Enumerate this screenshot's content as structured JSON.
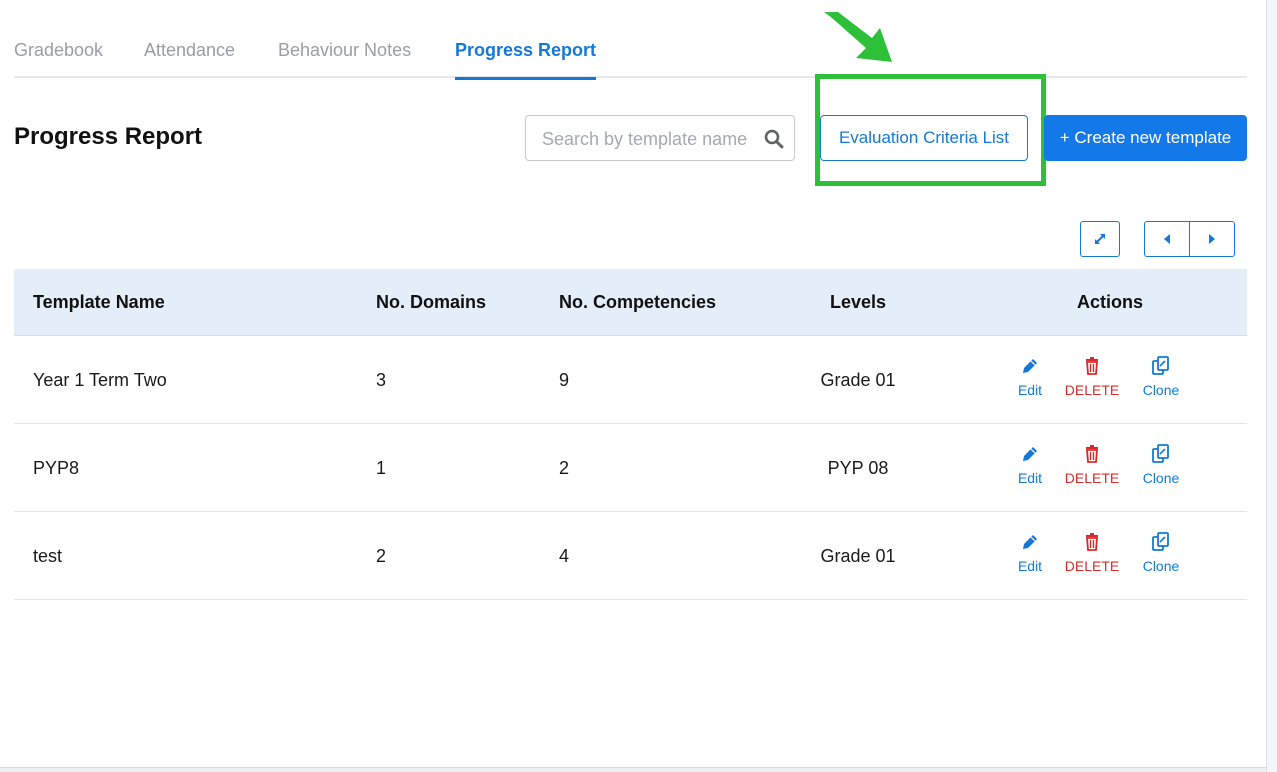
{
  "tabs": [
    {
      "label": "Gradebook",
      "active": false
    },
    {
      "label": "Attendance",
      "active": false
    },
    {
      "label": "Behaviour Notes",
      "active": false
    },
    {
      "label": "Progress Report",
      "active": true
    }
  ],
  "page": {
    "title": "Progress Report"
  },
  "search": {
    "placeholder": "Search by template name",
    "value": ""
  },
  "toolbar": {
    "evaluation_label": "Evaluation Criteria List",
    "create_label": "+ Create new template"
  },
  "table": {
    "headers": {
      "name": "Template Name",
      "domains": "No. Domains",
      "competencies": "No. Competencies",
      "levels": "Levels",
      "actions": "Actions"
    },
    "action_labels": {
      "edit": "Edit",
      "delete": "DELETE",
      "clone": "Clone"
    },
    "rows": [
      {
        "name": "Year 1 Term Two",
        "domains": "3",
        "competencies": "9",
        "levels": "Grade 01"
      },
      {
        "name": "PYP8",
        "domains": "1",
        "competencies": "2",
        "levels": "PYP 08"
      },
      {
        "name": "test",
        "domains": "2",
        "competencies": "4",
        "levels": "Grade 01"
      }
    ]
  },
  "icons": {
    "search": "search-icon",
    "expand": "expand-icon",
    "prev": "caret-left-icon",
    "next": "caret-right-icon",
    "edit": "pencil-icon",
    "delete": "trash-icon",
    "clone": "copy-icon"
  },
  "colors": {
    "accent": "#1479d4",
    "primary_button": "#1479e8",
    "danger": "#d62b2b",
    "highlight": "#2fc03a",
    "table_header_bg": "#e3eef9"
  }
}
